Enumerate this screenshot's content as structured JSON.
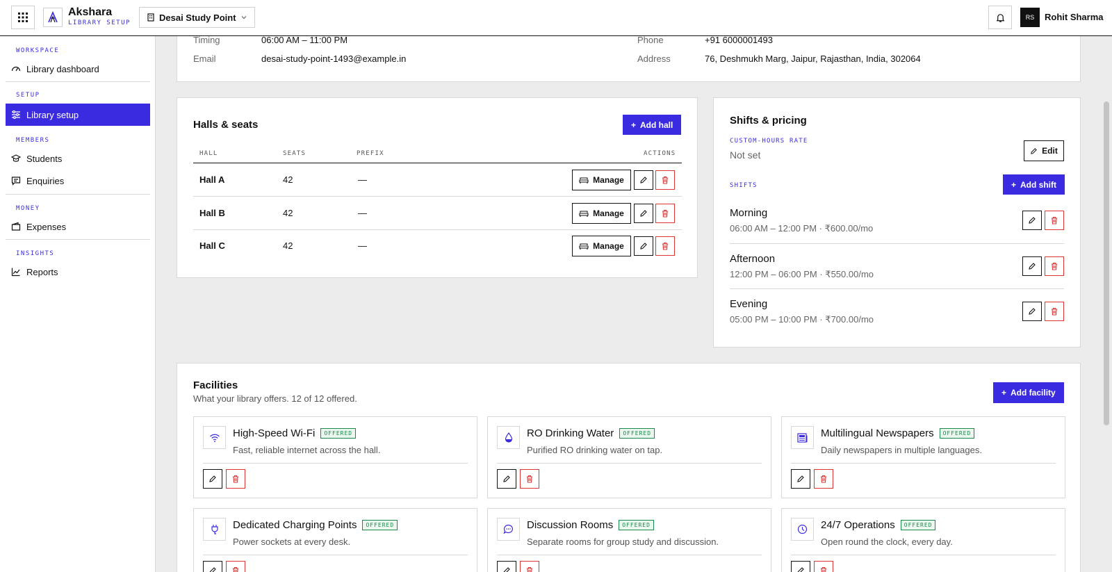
{
  "topbar": {
    "brand_name": "Akshara",
    "brand_sub": "LIBRARY SETUP",
    "library_selector": "Desai Study Point",
    "user_initials": "RS",
    "user_name": "Rohit Sharma"
  },
  "sidebar": {
    "sections": {
      "workspace": "WORKSPACE",
      "setup": "SETUP",
      "members": "MEMBERS",
      "money": "MONEY",
      "insights": "INSIGHTS"
    },
    "items": {
      "dashboard": "Library dashboard",
      "setup": "Library setup",
      "students": "Students",
      "enquiries": "Enquiries",
      "expenses": "Expenses",
      "reports": "Reports"
    }
  },
  "info": {
    "timing_label": "Timing",
    "timing_value": "06:00 AM – 11:00 PM",
    "email_label": "Email",
    "email_value": "desai-study-point-1493@example.in",
    "phone_label": "Phone",
    "phone_value": "+91 6000001493",
    "address_label": "Address",
    "address_value": "76, Deshmukh Marg, Jaipur, Rajasthan, India, 302064"
  },
  "halls": {
    "title": "Halls & seats",
    "add_label": "Add hall",
    "columns": {
      "hall": "HALL",
      "seats": "SEATS",
      "prefix": "PREFIX",
      "actions": "ACTIONS"
    },
    "manage_label": "Manage",
    "rows": [
      {
        "name": "Hall A",
        "seats": "42",
        "prefix": "—"
      },
      {
        "name": "Hall B",
        "seats": "42",
        "prefix": "—"
      },
      {
        "name": "Hall C",
        "seats": "42",
        "prefix": "—"
      }
    ]
  },
  "shifts": {
    "title": "Shifts & pricing",
    "custom_label": "CUSTOM-HOURS RATE",
    "custom_value": "Not set",
    "edit_label": "Edit",
    "shifts_label": "SHIFTS",
    "add_label": "Add shift",
    "items": [
      {
        "name": "Morning",
        "detail": "06:00 AM – 12:00 PM · ₹600.00/mo"
      },
      {
        "name": "Afternoon",
        "detail": "12:00 PM – 06:00 PM · ₹550.00/mo"
      },
      {
        "name": "Evening",
        "detail": "05:00 PM – 10:00 PM · ₹700.00/mo"
      }
    ]
  },
  "facilities": {
    "title": "Facilities",
    "subtitle": "What your library offers. 12 of 12 offered.",
    "add_label": "Add facility",
    "badge": "OFFERED",
    "items": [
      {
        "name": "High-Speed Wi-Fi",
        "desc": "Fast, reliable internet across the hall.",
        "icon": "wifi-icon"
      },
      {
        "name": "RO Drinking Water",
        "desc": "Purified RO drinking water on tap.",
        "icon": "water-drop-icon"
      },
      {
        "name": "Multilingual Newspapers",
        "desc": "Daily newspapers in multiple languages.",
        "icon": "newspaper-icon"
      },
      {
        "name": "Dedicated Charging Points",
        "desc": "Power sockets at every desk.",
        "icon": "plug-icon"
      },
      {
        "name": "Discussion Rooms",
        "desc": "Separate rooms for group study and discussion.",
        "icon": "chat-icon"
      },
      {
        "name": "24/7 Operations",
        "desc": "Open round the clock, every day.",
        "icon": "clock-icon"
      }
    ]
  },
  "colors": {
    "accent": "#3b2be0",
    "danger": "#d33333",
    "offered": "#1a8a4a"
  }
}
